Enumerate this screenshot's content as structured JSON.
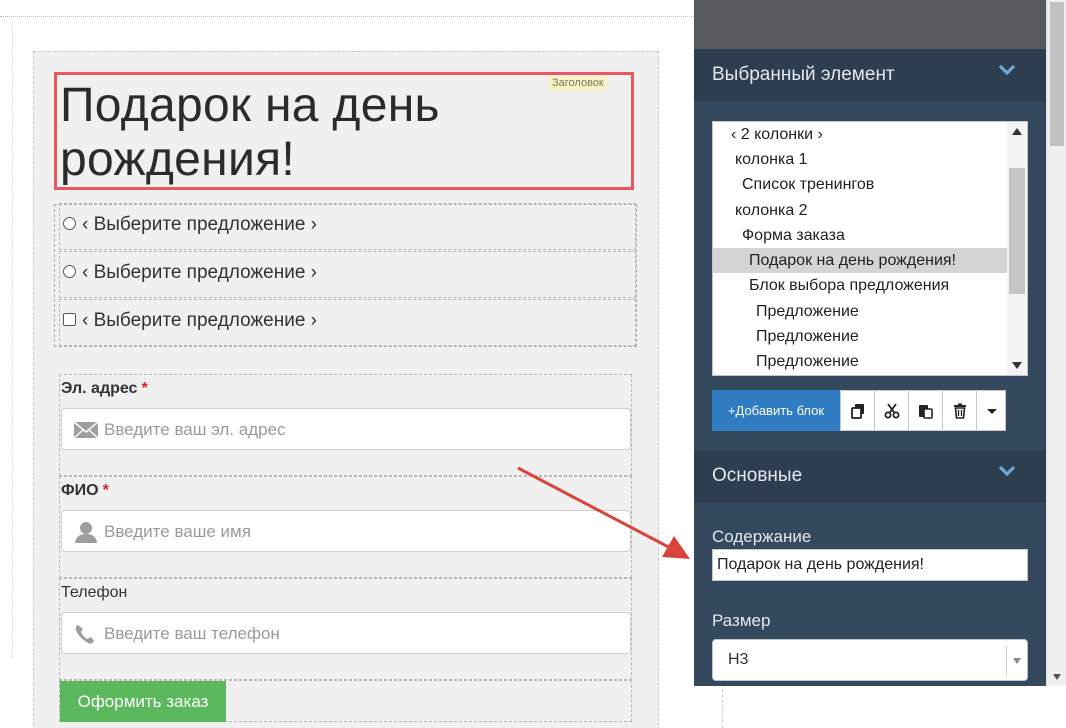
{
  "canvas": {
    "heading": "Подарок на день рождения!",
    "heading_tag": "Заголовок",
    "offers": [
      {
        "label": "‹ Выберите предложение ›",
        "control": "radio"
      },
      {
        "label": "‹ Выберите предложение ›",
        "control": "radio"
      },
      {
        "label": "‹ Выберите предложение ›",
        "control": "checkbox"
      }
    ],
    "fields": {
      "email": {
        "label": "Эл. адрес",
        "required_mark": "*",
        "placeholder": "Введите ваш эл. адрес",
        "icon": "envelope-icon"
      },
      "name": {
        "label": "ФИО",
        "required_mark": "*",
        "placeholder": "Введите ваше имя",
        "icon": "user-icon"
      },
      "phone": {
        "label": "Телефон",
        "placeholder": "Введите ваш телефон",
        "icon": "phone-icon"
      }
    },
    "submit_label": "Оформить заказ"
  },
  "panel": {
    "selected_section_title": "Выбранный элемент",
    "tree_items": [
      {
        "label": "‹ 2 колонки ›",
        "indent": 1
      },
      {
        "label": "колонка 1",
        "indent": 1
      },
      {
        "label": "Список тренингов",
        "indent": 2
      },
      {
        "label": "колонка 2",
        "indent": 1
      },
      {
        "label": "Форма заказа",
        "indent": 2
      },
      {
        "label": "Подарок на день рождения!",
        "indent": 3,
        "selected": true
      },
      {
        "label": "Блок выбора предложения",
        "indent": 3
      },
      {
        "label": "Предложение",
        "indent": 4
      },
      {
        "label": "Предложение",
        "indent": 4
      },
      {
        "label": "Предложение",
        "indent": 4
      }
    ],
    "add_block_label": "+Добавить блок",
    "main_section_title": "Основные",
    "content_label": "Содержание",
    "content_value": "Подарок на день рождения!",
    "size_label": "Размер",
    "size_value": "H3"
  },
  "colors": {
    "panel_bg": "#34495e",
    "section_header_bg": "#2c3e50",
    "add_button": "#2f7cc2",
    "submit_button": "#5cb85c",
    "selection_outline": "#e8595f",
    "required_mark": "#dd2222"
  }
}
